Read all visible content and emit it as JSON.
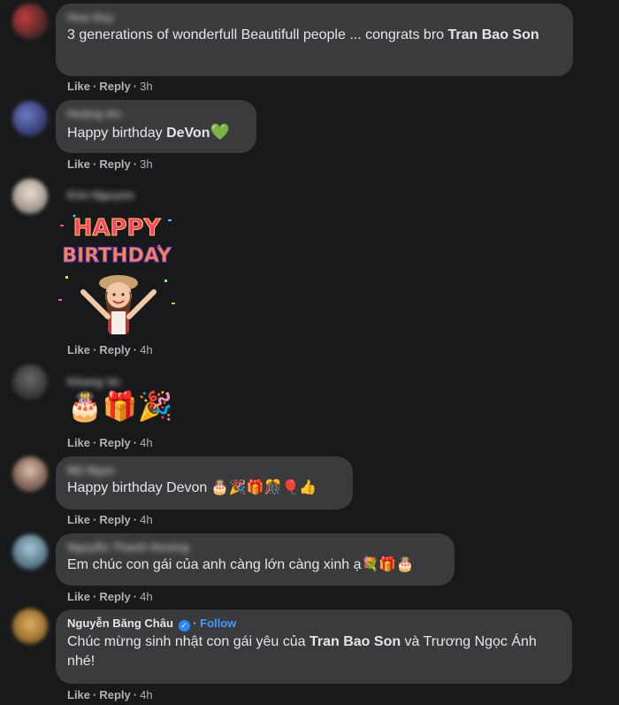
{
  "actions": {
    "like": "Like",
    "reply": "Reply",
    "separator": "·"
  },
  "comments": [
    {
      "author": "Hoa Huy",
      "text_pre": "3 generations of wonderfull Beautifull people ... congrats bro ",
      "text_bold": "Tran Bao Son",
      "time": "3h"
    },
    {
      "author": "Hoàng An",
      "text_pre": "Happy birthday ",
      "text_bold": "DeVon",
      "emoji": "💚",
      "time": "3h"
    },
    {
      "author": "Kim Nguyen",
      "sticker_line1": "HAPPY",
      "sticker_line2": "BIRTHDAY",
      "time": "4h"
    },
    {
      "author": "Khang Vo",
      "emojis": "🎂🎁🎉",
      "time": "4h"
    },
    {
      "author": "Mỹ Ngọc",
      "text": "Happy birthday Devon 🎂🎉🎁🎊🎈👍",
      "time": "4h"
    },
    {
      "author": "Nguyễn Thanh Hương",
      "text": "Em chúc con gái của anh càng lớn càng xinh ạ💐🎁🎂",
      "time": "4h"
    },
    {
      "author": "Nguyễn Băng Châu",
      "verified_mark": "✓",
      "follow": "Follow",
      "text_pre": "Chúc mừng sinh nhật con gái yêu của ",
      "text_bold": "Tran Bao Son",
      "text_post": " và Trương Ngọc Ánh nhé!",
      "time": "4h"
    }
  ],
  "colors": {
    "background": "#18191a",
    "bubble": "#3a3b3c",
    "text": "#e4e6eb",
    "secondary": "#b0b3b8",
    "link": "#4599ff"
  }
}
